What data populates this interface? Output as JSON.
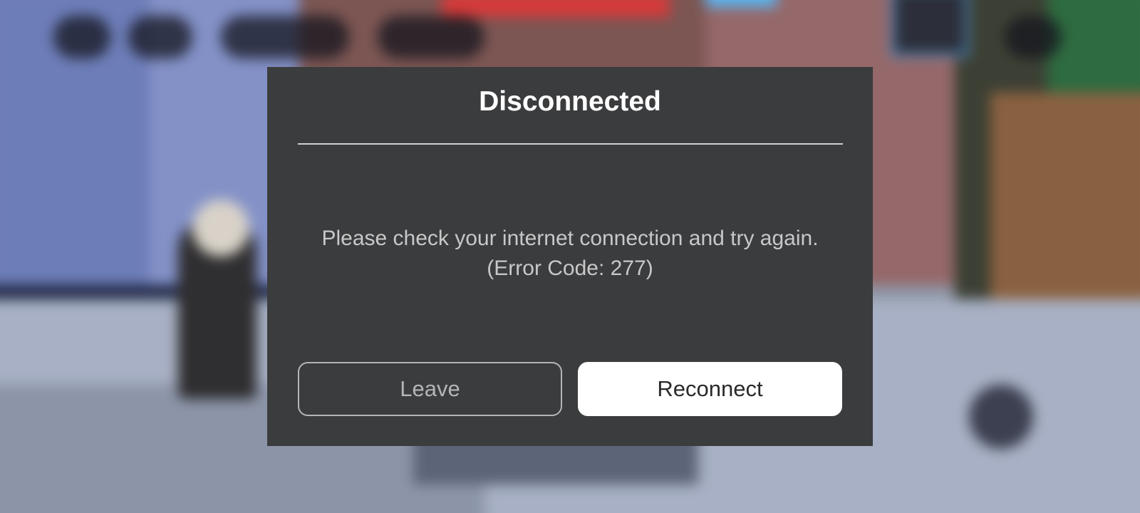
{
  "dialog": {
    "title": "Disconnected",
    "message_line1": "Please check your internet connection and try again.",
    "message_line2": "(Error Code: 277)",
    "leave_label": "Leave",
    "reconnect_label": "Reconnect"
  },
  "colors": {
    "dialog_background": "#3b3c3e",
    "primary_button": "#ffffff",
    "secondary_button_border": "#b5b5b5"
  }
}
